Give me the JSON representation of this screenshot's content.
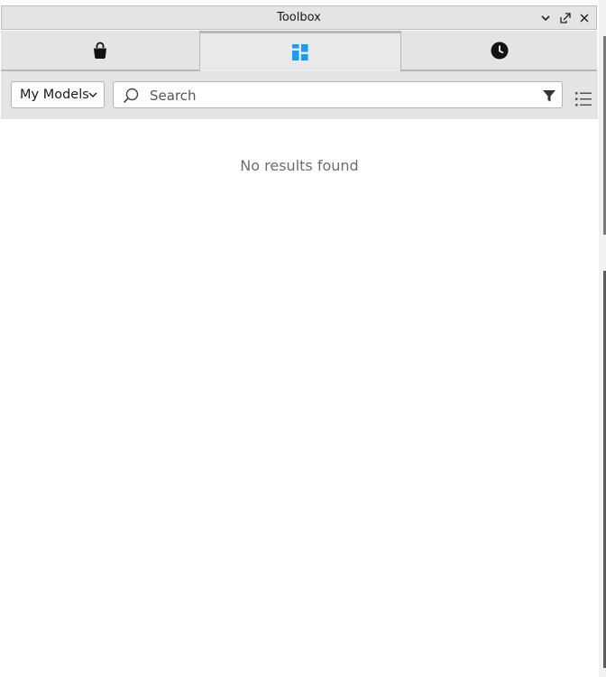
{
  "window": {
    "title": "Toolbox"
  },
  "titlebar_buttons": [
    "chevron-down-icon",
    "undock-icon",
    "close-icon"
  ],
  "tabs": [
    {
      "name": "marketplace",
      "icon": "shopping-bag-icon",
      "active": false
    },
    {
      "name": "inventory",
      "icon": "grid-icon",
      "active": true,
      "color": "#1a9cf0"
    },
    {
      "name": "recent",
      "icon": "clock-icon",
      "active": false
    }
  ],
  "toolbar": {
    "category": {
      "selected": "My Models"
    },
    "search": {
      "value": "",
      "placeholder": "Search"
    }
  },
  "results": {
    "empty_message": "No results found"
  },
  "colors": {
    "accent": "#1a9cf0",
    "panel_bg": "#e4e4e4",
    "content_bg": "#ffffff",
    "muted_text": "#6e6e6e"
  }
}
